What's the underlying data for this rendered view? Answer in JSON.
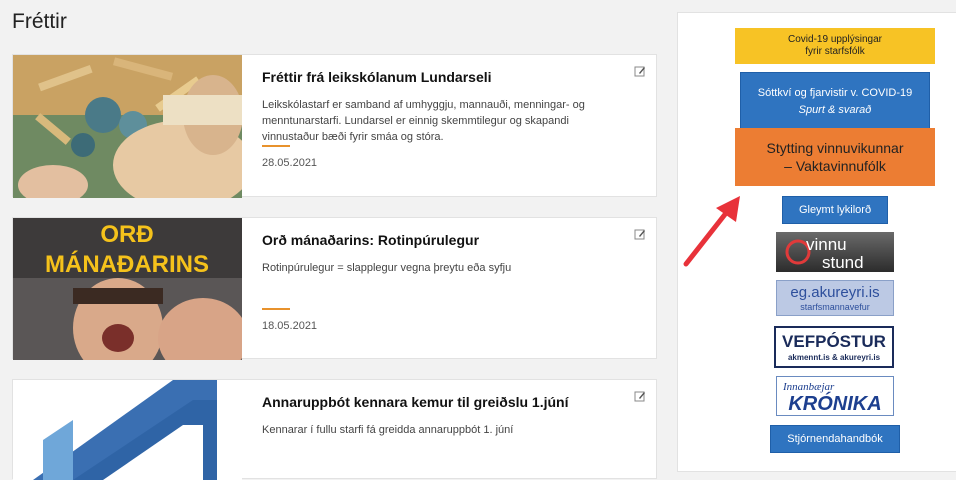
{
  "page": {
    "title": "Fréttir"
  },
  "news": [
    {
      "title": "Fréttir frá leikskólanum Lundarseli",
      "excerpt": "Leikskólastarf er samband af umhyggju, mannauði, menningar- og menntunarstarfi. Lundarsel er einnig skemmtilegur og skapandi vinnustaður bæði fyrir smáa og stóra.",
      "date": "28.05.2021"
    },
    {
      "title": "Orð mánaðarins: Rotinpúrulegur",
      "excerpt": "Rotinpúrulegur = slapplegur vegna þreytu eða syfju",
      "date": "18.05.2021",
      "image_text": [
        "ORÐ",
        "MÁNAÐARINS"
      ]
    },
    {
      "title": "Annaruppbót kennara kemur til greiðslu 1.júní",
      "excerpt": "Kennarar í fullu starfi fá greidda annaruppbót 1. júní"
    }
  ],
  "sidebar": {
    "covid_line1": "Covid-19 upplýsingar",
    "covid_line2": "fyrir starfsfólk",
    "sottkvi_line1": "Sóttkví og fjarvistir v. COVID-19",
    "sottkvi_line2": "Spurt & svarað",
    "stytting_line1": "Stytting vinnuvikunnar",
    "stytting_line2": "– Vaktavinnufólk",
    "gleymt": "Gleymt lykilorð",
    "vinnustund_line1": "vinnu",
    "vinnustund_line2": "stund",
    "eg_line1": "eg.akureyri.is",
    "eg_line2": "starfsmannavefur",
    "vefpostur_line1": "VEFPÓSTUR",
    "vefpostur_line2": "akmennt.is & akureyri.is",
    "kronika_line1": "Innanbæjar",
    "kronika_line2": "KRÓNIKA",
    "stjorn": "Stjórnendahandbók"
  },
  "colors": {
    "accent_orange": "#ec7d33",
    "yellow": "#f7c325",
    "blue": "#2f74c0",
    "arrow_red": "#e8323a"
  }
}
